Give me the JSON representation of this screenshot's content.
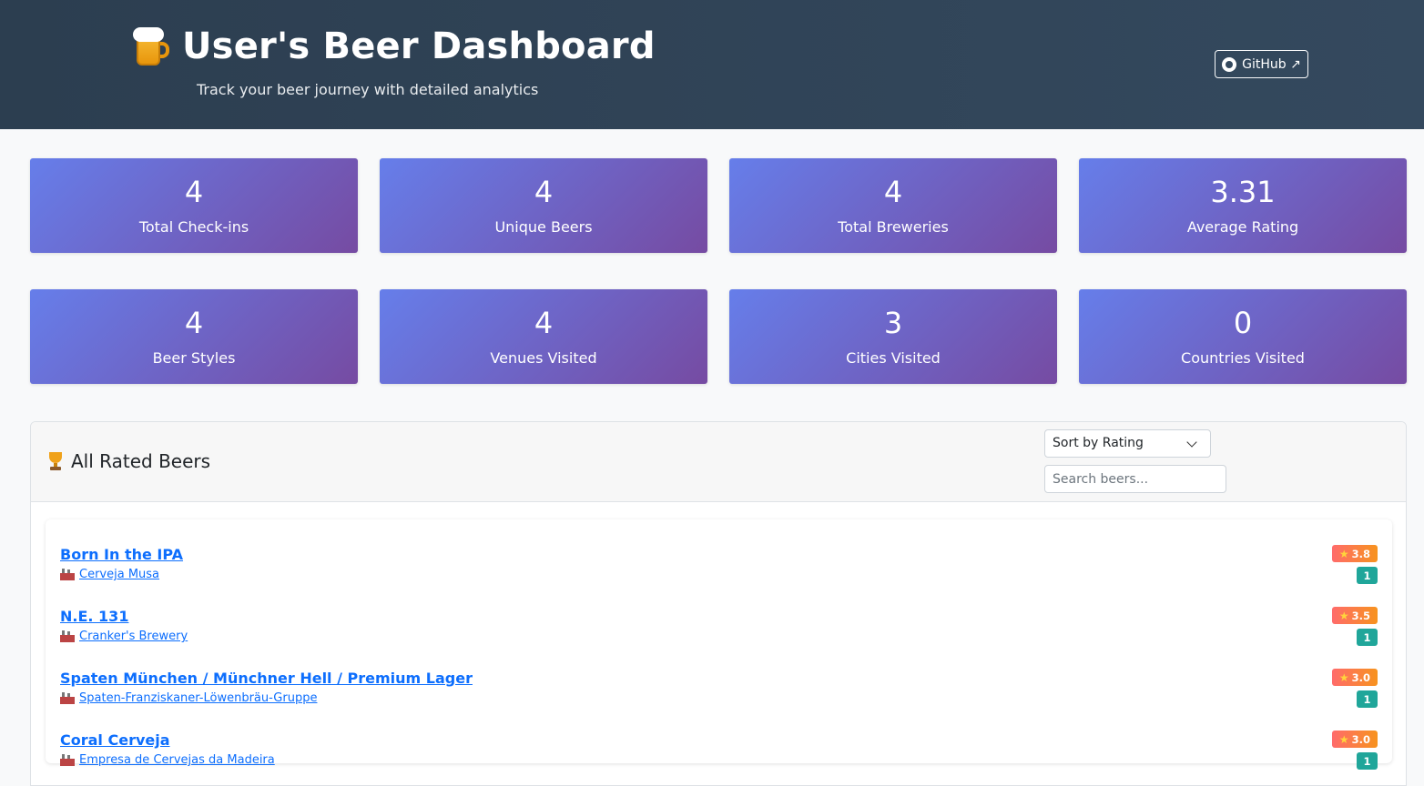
{
  "header": {
    "title": "User's Beer Dashboard",
    "subtitle": "Track your beer journey with detailed analytics",
    "github_label": "GitHub ↗"
  },
  "stats": [
    {
      "value": "4",
      "label": "Total Check-ins"
    },
    {
      "value": "4",
      "label": "Unique Beers"
    },
    {
      "value": "4",
      "label": "Total Breweries"
    },
    {
      "value": "3.31",
      "label": "Average Rating"
    },
    {
      "value": "4",
      "label": "Beer Styles"
    },
    {
      "value": "4",
      "label": "Venues Visited"
    },
    {
      "value": "3",
      "label": "Cities Visited"
    },
    {
      "value": "0",
      "label": "Countries Visited"
    }
  ],
  "rated_beers": {
    "title": "All Rated Beers",
    "sort_selected": "Sort by Rating",
    "search_placeholder": "Search beers...",
    "items": [
      {
        "name": "Born In the IPA",
        "brewery": "Cerveja Musa",
        "rating": "3.8",
        "count": "1"
      },
      {
        "name": "N.E. 131",
        "brewery": "Cranker's Brewery",
        "rating": "3.5",
        "count": "1"
      },
      {
        "name": "Spaten München / Münchner Hell / Premium Lager",
        "brewery": "Spaten-Franziskaner-Löwenbräu-Gruppe",
        "rating": "3.0",
        "count": "1"
      },
      {
        "name": "Coral Cerveja",
        "brewery": "Empresa de Cervejas da Madeira",
        "rating": "3.0",
        "count": "1"
      }
    ]
  },
  "colors": {
    "header_bg": "#2c3e50",
    "card_gradient_start": "#667eea",
    "card_gradient_end": "#764ba2",
    "link": "#0d6efd",
    "rating_badge": "#f7931e",
    "count_badge": "#20a69a"
  },
  "icons": {
    "header": "beer-mug-icon",
    "panel": "trophy-icon",
    "brewery": "factory-icon",
    "rating": "star-icon",
    "github": "github-icon",
    "sort": "chevron-down-icon"
  }
}
